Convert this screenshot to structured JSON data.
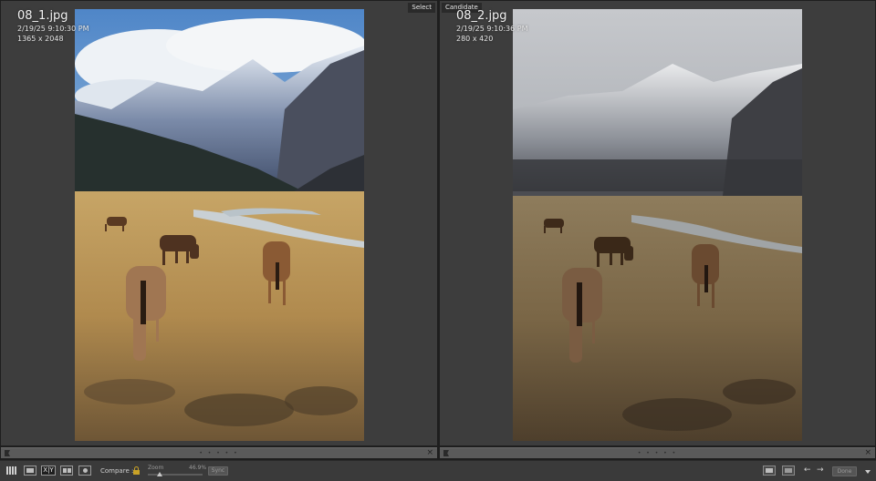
{
  "left_pane": {
    "tag": "Select",
    "filename": "08_1.jpg",
    "datetime": "2/19/25 9:10:30 PM",
    "dimensions": "1365 x 2048"
  },
  "right_pane": {
    "tag": "Candidate",
    "filename": "08_2.jpg",
    "datetime": "2/19/25 9:10:36 PM",
    "dimensions": "280 x 420"
  },
  "toolbar": {
    "compare_view_label": "X|Y",
    "compare_label": "Compare :",
    "zoom_label": "Zoom",
    "zoom_value": "46.9%",
    "zoom_level": 0.22,
    "sync_label": "Sync",
    "done_label": "Done",
    "prev_arrow": "←",
    "next_arrow": "→"
  },
  "pane_bar": {
    "dots": "• • • • •",
    "close": "×"
  },
  "colors": {
    "lock": "#c9a227",
    "pane_bg": "#3d3d3d",
    "toolbar_bg": "#3a3a3a"
  },
  "icons": [
    "grid-icon",
    "loupe-icon",
    "compare-icon",
    "survey-icon",
    "people-icon",
    "lock-icon",
    "swap-icon",
    "make-select-icon",
    "flag-icon",
    "close-icon"
  ]
}
